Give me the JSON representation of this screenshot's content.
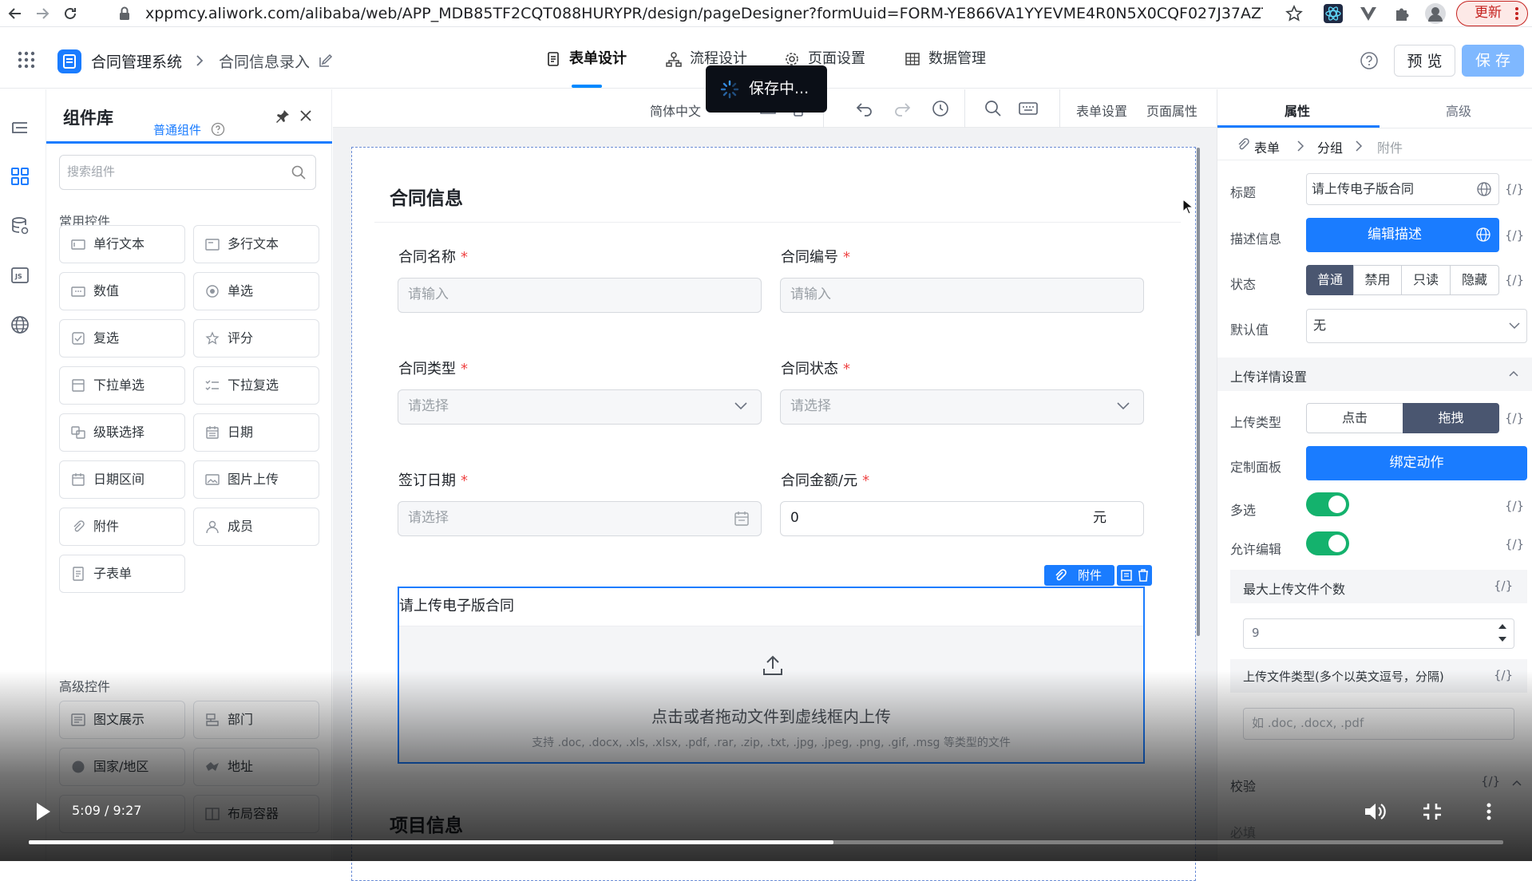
{
  "browser": {
    "url": "xppmcy.aliwork.com/alibaba/web/APP_MDB85TF2CQT088HURYPR/design/pageDesigner?formUuid=FORM-YE866VA1YYEVME4R0N5X0CQF027J37AZTU2...",
    "update_label": "更新"
  },
  "header": {
    "app_name": "合同管理系统",
    "page_name": "合同信息录入",
    "tabs": [
      "表单设计",
      "流程设计",
      "页面设置",
      "数据管理"
    ],
    "preview_label": "预 览",
    "save_label": "保 存"
  },
  "toast": {
    "text": "保存中..."
  },
  "library": {
    "title": "组件库",
    "tab_label": "普通组件",
    "search_placeholder": "搜索组件",
    "common_section": "常用控件",
    "common": [
      "单行文本",
      "多行文本",
      "数值",
      "单选",
      "复选",
      "评分",
      "下拉单选",
      "下拉复选",
      "级联选择",
      "日期",
      "日期区间",
      "图片上传",
      "附件",
      "成员",
      "子表单"
    ],
    "advanced_section": "高级控件",
    "advanced": [
      "图文展示",
      "部门",
      "国家/地区",
      "地址",
      "",
      "布局容器"
    ]
  },
  "toolbar": {
    "language": "简体中文",
    "form_settings": "表单设置",
    "page_props": "页面属性"
  },
  "form": {
    "section_title": "合同信息",
    "fields": [
      {
        "label": "合同名称",
        "placeholder": "请输入"
      },
      {
        "label": "合同编号",
        "placeholder": "请输入"
      },
      {
        "label": "合同类型",
        "placeholder": "请选择"
      },
      {
        "label": "合同状态",
        "placeholder": "请选择"
      },
      {
        "label": "签订日期",
        "placeholder": "请选择"
      },
      {
        "label": "合同金额/元",
        "value": "0",
        "suffix": "元"
      }
    ],
    "required_mark": "*",
    "attach_tag": "附件",
    "upload_label": "请上传电子版合同",
    "upload_main": "点击或者拖动文件到虚线框内上传",
    "upload_hint": "支持 .doc, .docx, .xls, .xlsx, .pdf, .rar, .zip, .txt, .jpg, .jpeg, .png, .gif, .msg 等类型的文件",
    "next_section": "项目信息"
  },
  "props": {
    "tabs": [
      "属性",
      "高级"
    ],
    "crumbs": [
      "表单",
      "分组",
      "附件"
    ],
    "braces": "{/}",
    "title_label": "标题",
    "title_value": "请上传电子版合同",
    "desc_label": "描述信息",
    "desc_button": "编辑描述",
    "state_label": "状态",
    "states": [
      "普通",
      "禁用",
      "只读",
      "隐藏"
    ],
    "default_label": "默认值",
    "default_value": "无",
    "upload_section": "上传详情设置",
    "upload_type_label": "上传类型",
    "upload_types": [
      "点击",
      "拖拽"
    ],
    "panel_label": "定制面板",
    "panel_button": "绑定动作",
    "multi_label": "多选",
    "multi_on": true,
    "editable_label": "允许编辑",
    "editable_on": true,
    "max_files_label": "最大上传文件个数",
    "max_files_value": "9",
    "file_types_label": "上传文件类型(多个以英文逗号，分隔)",
    "file_types_placeholder": "如 .doc, .docx, .pdf",
    "validate_label": "校验",
    "faded_label": "必填"
  },
  "video": {
    "time": "5:09 / 9:27",
    "progress": 0.546
  },
  "colors": {
    "primary": "#0089ff",
    "required": "#ef4444",
    "toggle_on": "#14b26d",
    "segment_active": "#4a5670"
  }
}
